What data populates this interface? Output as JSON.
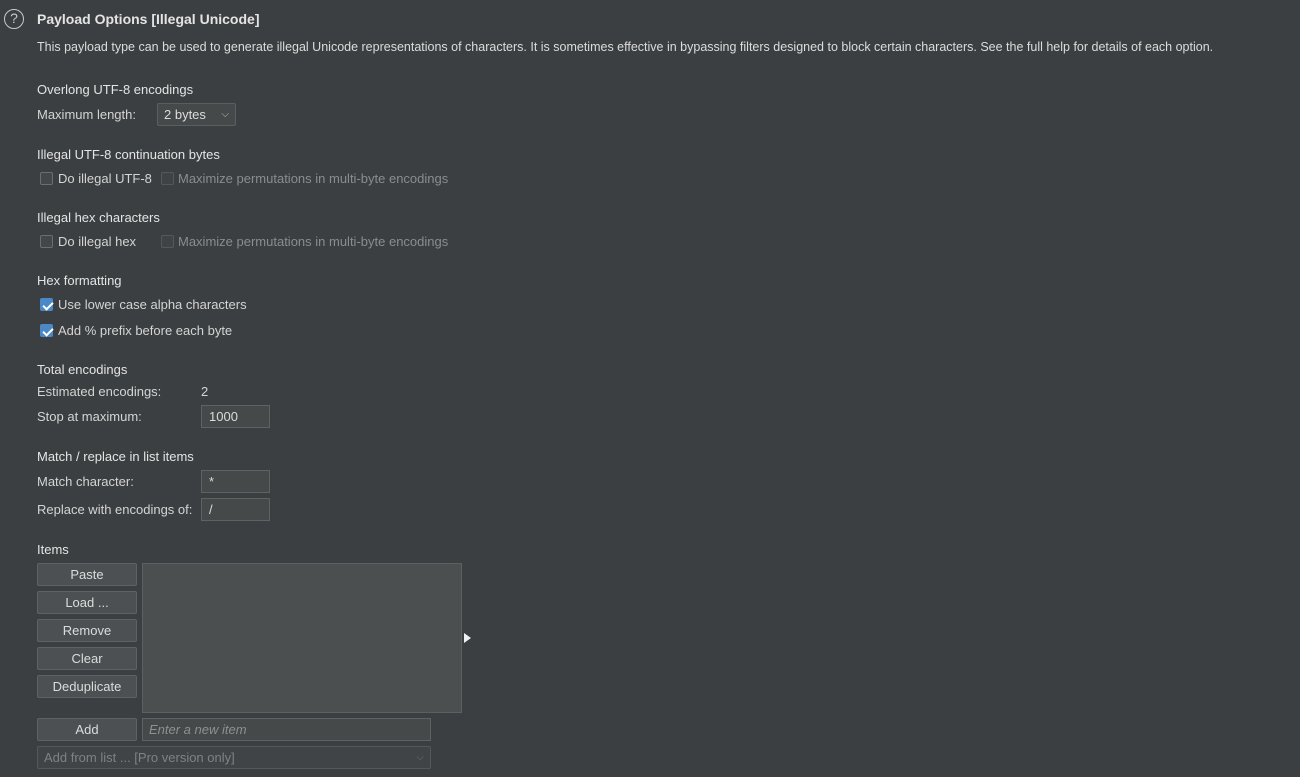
{
  "header": {
    "title": "Payload Options [Illegal Unicode]",
    "description": "This payload type can be used to generate illegal Unicode representations of characters. It is sometimes effective in bypassing filters designed to block certain characters. See the full help for details of each option.",
    "help_icon": "?"
  },
  "overlong": {
    "heading": "Overlong UTF-8 encodings",
    "max_length_label": "Maximum length:",
    "max_length_value": "2 bytes",
    "chevron": "⌵"
  },
  "continuation": {
    "heading": "Illegal UTF-8 continuation bytes",
    "do_label": "Do illegal UTF-8",
    "do_checked": false,
    "maximize_label": "Maximize permutations in multi-byte encodings",
    "maximize_checked": false,
    "maximize_enabled": false
  },
  "hexchars": {
    "heading": "Illegal hex characters",
    "do_label": "Do illegal hex",
    "do_checked": false,
    "maximize_label": "Maximize permutations in multi-byte encodings",
    "maximize_checked": false,
    "maximize_enabled": false
  },
  "hexformat": {
    "heading": "Hex formatting",
    "lower_label": "Use lower case alpha characters",
    "lower_checked": true,
    "prefix_label": "Add % prefix before each byte",
    "prefix_checked": true
  },
  "total": {
    "heading": "Total encodings",
    "estimated_label": "Estimated encodings:",
    "estimated_value": "2",
    "stop_label": "Stop at maximum:",
    "stop_value": "1000"
  },
  "match": {
    "heading": "Match / replace in list items",
    "match_label": "Match character:",
    "match_value": "*",
    "replace_label": "Replace with encodings of:",
    "replace_value": "/"
  },
  "items": {
    "heading": "Items",
    "buttons": [
      "Paste",
      "Load ...",
      "Remove",
      "Clear",
      "Deduplicate"
    ],
    "add_label": "Add",
    "new_item_placeholder": "Enter a new item",
    "add_from_list": "Add from list ... [Pro version only]",
    "chevron": "⌵"
  },
  "colors": {
    "background": "#3c3f41",
    "checkbox_accent": "#4a88c7"
  }
}
